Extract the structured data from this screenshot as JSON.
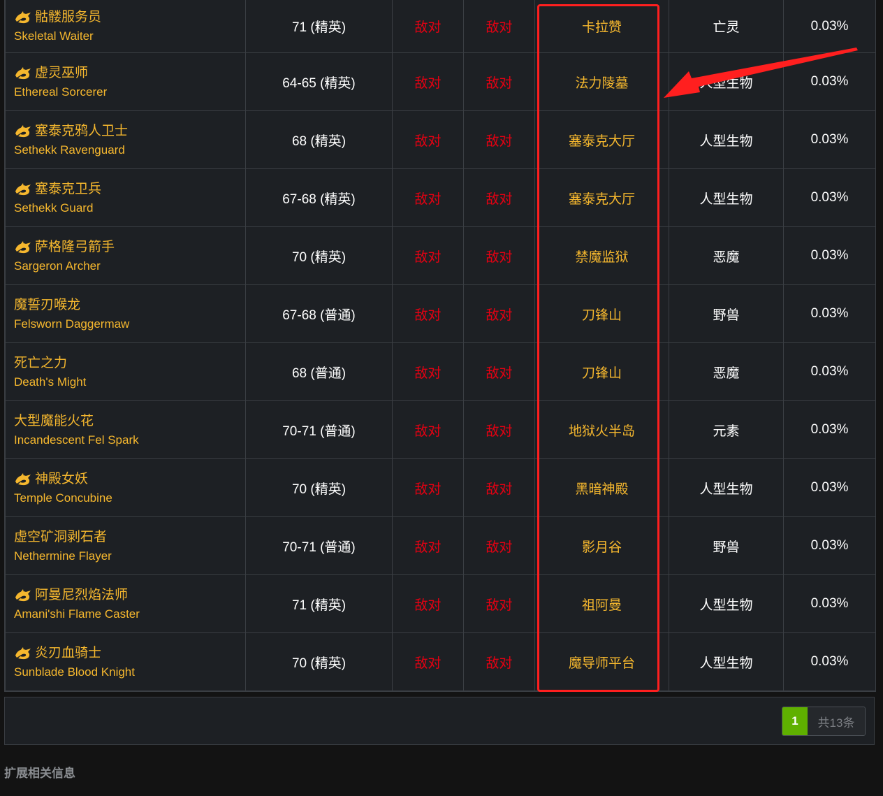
{
  "rows": [
    {
      "zh": "骷髅服务员",
      "en": "Skeletal Waiter",
      "elite": true,
      "level": "71 (精英)",
      "faction1": "敌对",
      "faction2": "敌对",
      "zone": "卡拉赞",
      "type": "亡灵",
      "chance": "0.03%"
    },
    {
      "zh": "虚灵巫师",
      "en": "Ethereal Sorcerer",
      "elite": true,
      "level": "64-65 (精英)",
      "faction1": "敌对",
      "faction2": "敌对",
      "zone": "法力陵墓",
      "type": "人型生物",
      "chance": "0.03%"
    },
    {
      "zh": "塞泰克鸦人卫士",
      "en": "Sethekk Ravenguard",
      "elite": true,
      "level": "68 (精英)",
      "faction1": "敌对",
      "faction2": "敌对",
      "zone": "塞泰克大厅",
      "type": "人型生物",
      "chance": "0.03%"
    },
    {
      "zh": "塞泰克卫兵",
      "en": "Sethekk Guard",
      "elite": true,
      "level": "67-68 (精英)",
      "faction1": "敌对",
      "faction2": "敌对",
      "zone": "塞泰克大厅",
      "type": "人型生物",
      "chance": "0.03%"
    },
    {
      "zh": "萨格隆弓箭手",
      "en": "Sargeron Archer",
      "elite": true,
      "level": "70 (精英)",
      "faction1": "敌对",
      "faction2": "敌对",
      "zone": "禁魔监狱",
      "type": "恶魔",
      "chance": "0.03%"
    },
    {
      "zh": "魔誓刃喉龙",
      "en": "Felsworn Daggermaw",
      "elite": false,
      "level": "67-68 (普通)",
      "faction1": "敌对",
      "faction2": "敌对",
      "zone": "刀锋山",
      "type": "野兽",
      "chance": "0.03%"
    },
    {
      "zh": "死亡之力",
      "en": "Death's Might",
      "elite": false,
      "level": "68 (普通)",
      "faction1": "敌对",
      "faction2": "敌对",
      "zone": "刀锋山",
      "type": "恶魔",
      "chance": "0.03%"
    },
    {
      "zh": "大型魔能火花",
      "en": "Incandescent Fel Spark",
      "elite": false,
      "level": "70-71 (普通)",
      "faction1": "敌对",
      "faction2": "敌对",
      "zone": "地狱火半岛",
      "type": "元素",
      "chance": "0.03%"
    },
    {
      "zh": "神殿女妖",
      "en": "Temple Concubine",
      "elite": true,
      "level": "70 (精英)",
      "faction1": "敌对",
      "faction2": "敌对",
      "zone": "黑暗神殿",
      "type": "人型生物",
      "chance": "0.03%"
    },
    {
      "zh": "虚空矿洞剥石者",
      "en": "Nethermine Flayer",
      "elite": false,
      "level": "70-71 (普通)",
      "faction1": "敌对",
      "faction2": "敌对",
      "zone": "影月谷",
      "type": "野兽",
      "chance": "0.03%"
    },
    {
      "zh": "阿曼尼烈焰法师",
      "en": "Amani'shi Flame Caster",
      "elite": true,
      "level": "71 (精英)",
      "faction1": "敌对",
      "faction2": "敌对",
      "zone": "祖阿曼",
      "type": "人型生物",
      "chance": "0.03%"
    },
    {
      "zh": "炎刃血骑士",
      "en": "Sunblade Blood Knight",
      "elite": true,
      "level": "70 (精英)",
      "faction1": "敌对",
      "faction2": "敌对",
      "zone": "魔导师平台",
      "type": "人型生物",
      "chance": "0.03%"
    }
  ],
  "pagination": {
    "current_page": "1",
    "total_text": "共13条"
  },
  "section": {
    "title": "扩展相关信息"
  },
  "colors": {
    "accent": "#f5b72e",
    "hostile": "#e60012",
    "page_active": "#5fb000",
    "highlight": "#ff1f1f"
  }
}
